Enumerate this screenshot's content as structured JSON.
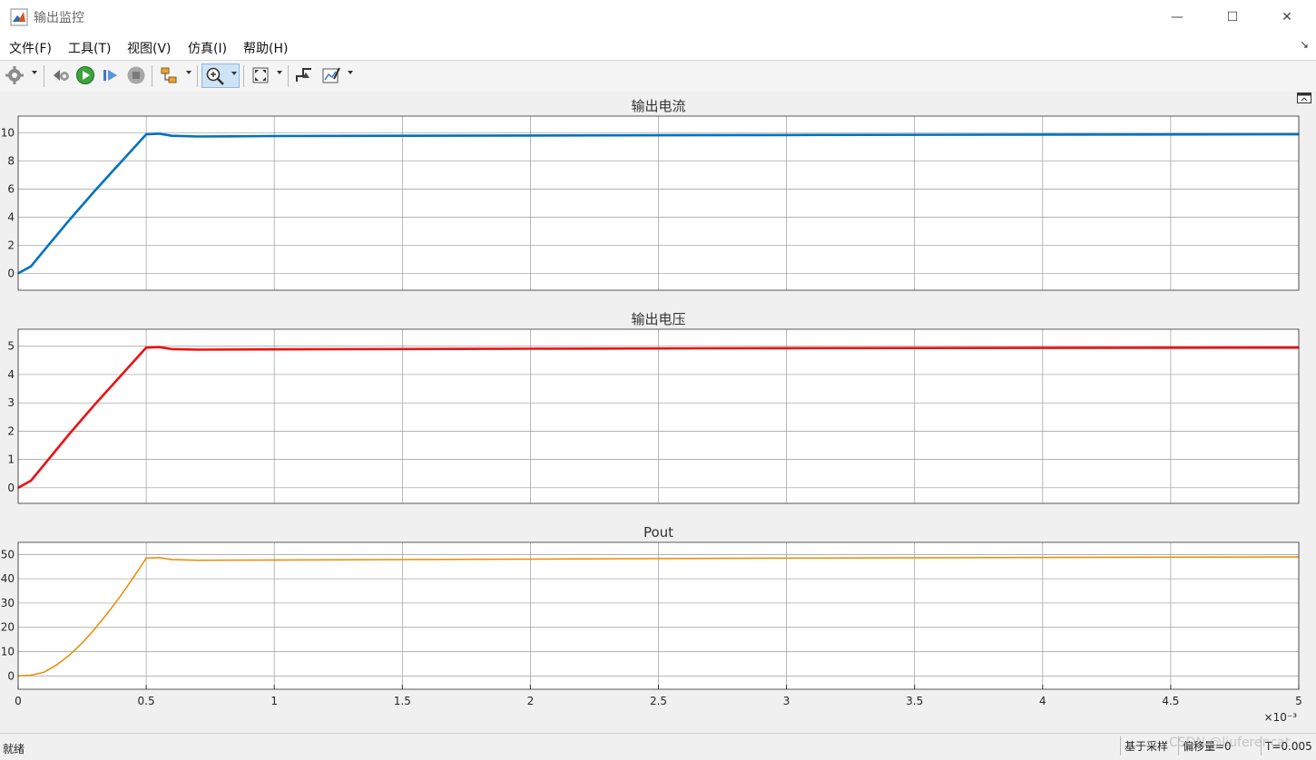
{
  "window": {
    "title": "输出监控",
    "min_glyph": "—",
    "max_glyph": "☐",
    "close_glyph": "✕"
  },
  "menu": [
    "文件(F)",
    "工具(T)",
    "视图(V)",
    "仿真(I)",
    "帮助(H)"
  ],
  "menu_corner_glyph": "↘",
  "toolbar": [
    "settings-icon",
    "revert-icon",
    "run-icon",
    "step-forward-icon",
    "stop-icon",
    "highlight-block-icon",
    "zoom-icon",
    "zoom-to-fit-icon",
    "triggers-icon",
    "style-icon"
  ],
  "status": {
    "left": "就绪",
    "sampling": "基于采样",
    "offset": "偏移量=0",
    "time": "T=0.005"
  },
  "watermark": "CSDN @liuferencat",
  "colors": {
    "current": "#0072BD",
    "voltage": "#EE1010",
    "power": "#EB8A00",
    "grid": "#9a9a9a",
    "axes_bg": "#ffffff"
  },
  "chart_data": [
    {
      "type": "line",
      "title": "输出电流",
      "xlim": [
        0,
        5
      ],
      "ylim": [
        -1.2,
        11.2
      ],
      "yticks": [
        0,
        2,
        4,
        6,
        8,
        10
      ],
      "ytick_labels": [
        "0",
        "2",
        "4",
        "6",
        "8",
        "10"
      ],
      "grid": true,
      "series": [
        {
          "color": "#0072BD",
          "x": [
            0,
            0.05,
            0.1,
            0.2,
            0.3,
            0.4,
            0.5,
            0.55,
            0.6,
            0.7,
            1,
            2,
            3,
            4,
            5
          ],
          "y": [
            0,
            0.5,
            1.6,
            3.8,
            5.9,
            7.9,
            9.9,
            9.95,
            9.8,
            9.75,
            9.78,
            9.82,
            9.85,
            9.88,
            9.9
          ]
        }
      ]
    },
    {
      "type": "line",
      "title": "输出电压",
      "xlim": [
        0,
        5
      ],
      "ylim": [
        -0.55,
        5.6
      ],
      "yticks": [
        0,
        1,
        2,
        3,
        4,
        5
      ],
      "ytick_labels": [
        "0",
        "1",
        "2",
        "3",
        "4",
        "5"
      ],
      "grid": true,
      "series": [
        {
          "color": "#EE1010",
          "x": [
            0,
            0.05,
            0.1,
            0.2,
            0.3,
            0.4,
            0.5,
            0.55,
            0.6,
            0.7,
            1,
            2,
            3,
            4,
            5
          ],
          "y": [
            0,
            0.25,
            0.8,
            1.9,
            2.95,
            3.95,
            4.95,
            4.97,
            4.9,
            4.88,
            4.89,
            4.91,
            4.93,
            4.94,
            4.95
          ]
        }
      ]
    },
    {
      "type": "line",
      "title": "Pout",
      "xlim": [
        0,
        5
      ],
      "ylim": [
        -5.5,
        55
      ],
      "yticks": [
        0,
        10,
        20,
        30,
        40,
        50
      ],
      "ytick_labels": [
        "0",
        "10",
        "20",
        "30",
        "40",
        "50"
      ],
      "xticks": [
        0,
        0.5,
        1,
        1.5,
        2,
        2.5,
        3,
        3.5,
        4,
        4.5,
        5
      ],
      "xtick_labels": [
        "0",
        "0.5",
        "1",
        "1.5",
        "2",
        "2.5",
        "3",
        "3.5",
        "4",
        "4.5",
        "5"
      ],
      "x_exponent": "×10⁻³",
      "grid": true,
      "series": [
        {
          "color": "#EB8A00",
          "x": [
            0,
            0.05,
            0.1,
            0.15,
            0.2,
            0.25,
            0.3,
            0.35,
            0.4,
            0.45,
            0.5,
            0.55,
            0.6,
            0.7,
            1,
            2,
            3,
            4,
            5
          ],
          "y": [
            0,
            0.3,
            1.5,
            4.5,
            8.5,
            13.5,
            19.5,
            26,
            33,
            40.5,
            48.5,
            48.7,
            47.9,
            47.6,
            47.7,
            48.1,
            48.5,
            48.8,
            49.0
          ]
        }
      ]
    }
  ]
}
